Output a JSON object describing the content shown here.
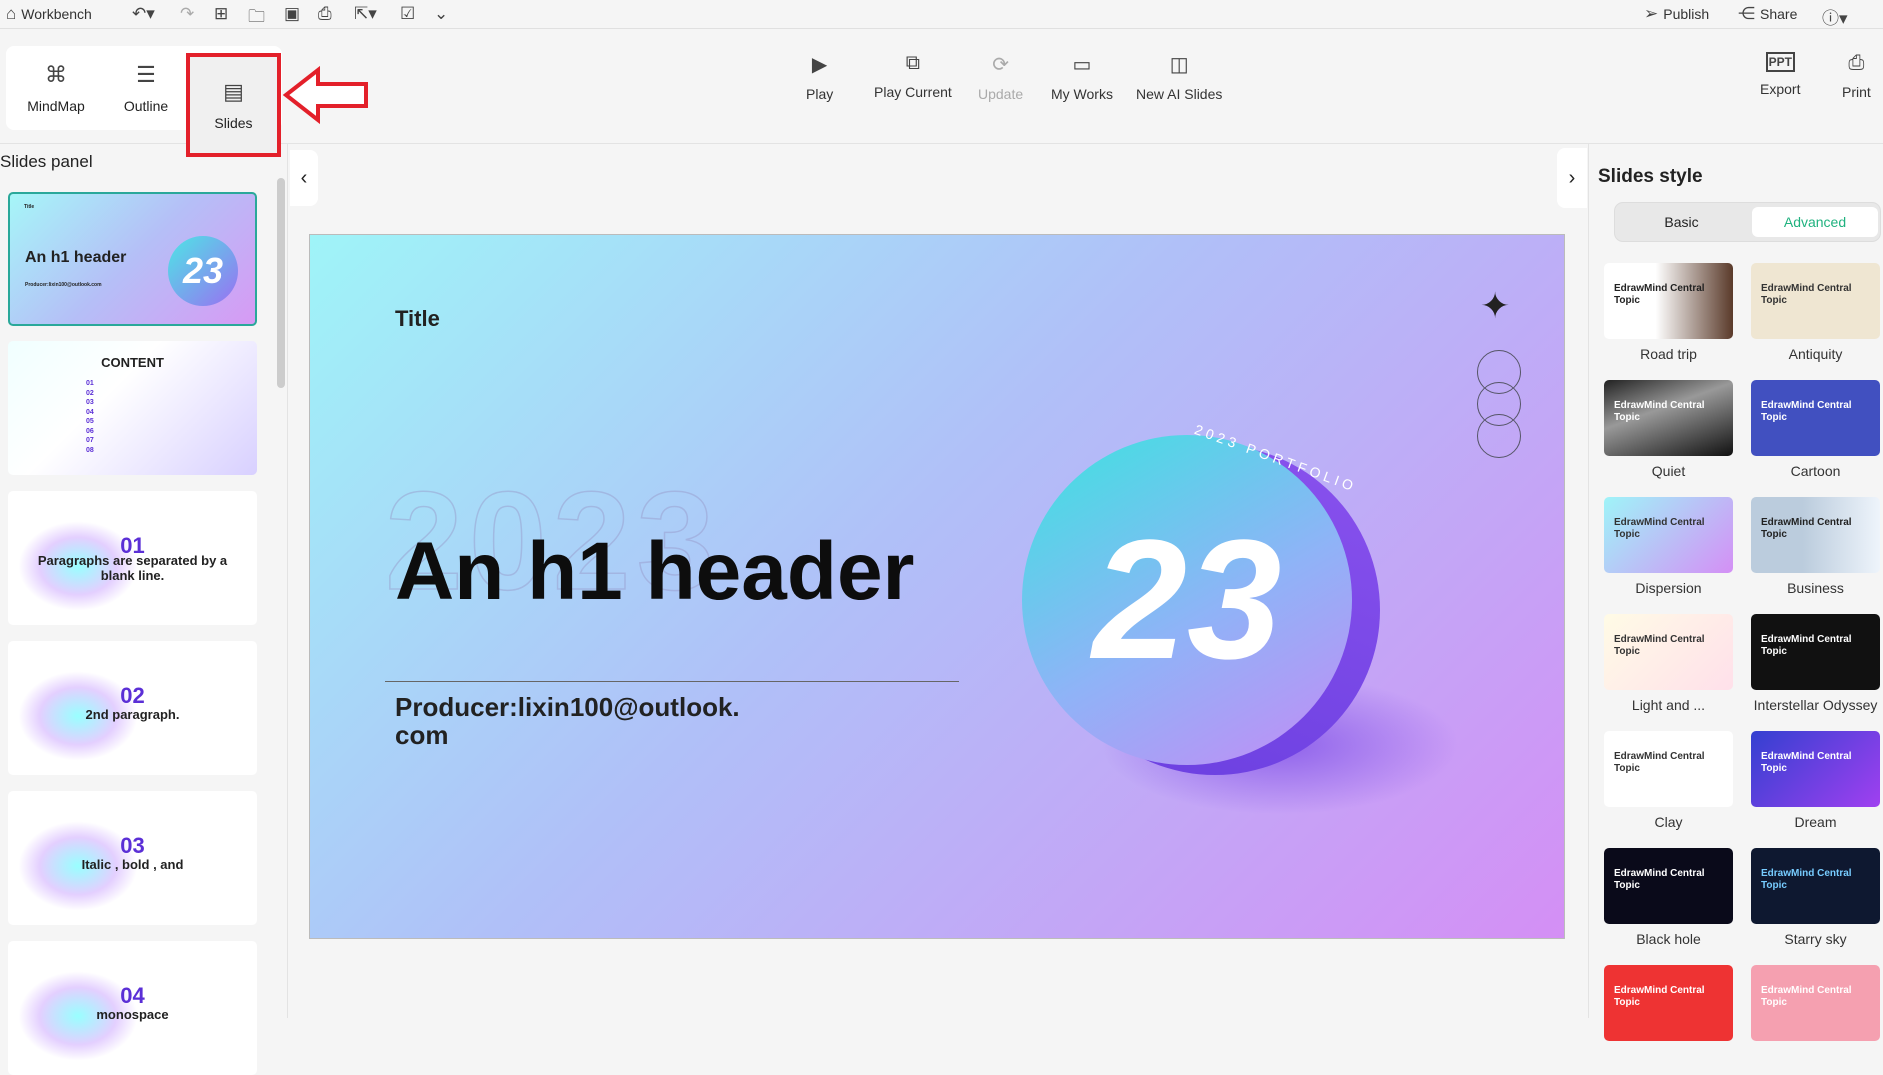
{
  "topbar": {
    "workbench": "Workbench",
    "publish": "Publish",
    "share": "Share"
  },
  "modes": [
    {
      "label": "MindMap"
    },
    {
      "label": "Outline"
    },
    {
      "label": "Slides"
    }
  ],
  "tools": [
    {
      "label": "Play"
    },
    {
      "label": "Play Current"
    },
    {
      "label": "Update",
      "disabled": true
    },
    {
      "label": "My Works"
    },
    {
      "label": "New AI Slides"
    }
  ],
  "right_tools": [
    {
      "label": "Export",
      "icon": "PPT"
    },
    {
      "label": "Print"
    }
  ],
  "slides_panel": {
    "title": "Slides panel",
    "slides": [
      {
        "title": "Title",
        "h1": "An h1 header",
        "producer": "Producer:lixin100@outlook.com",
        "num": "23"
      },
      {
        "title": "CONTENT",
        "items": [
          "01",
          "02",
          "03",
          "04",
          "05",
          "06",
          "07",
          "08"
        ]
      },
      {
        "num": "01",
        "text": "Paragraphs are separated by a blank line."
      },
      {
        "num": "02",
        "text": "2nd paragraph."
      },
      {
        "num": "03",
        "text": "Italic , bold , and"
      },
      {
        "num": "04",
        "text": "monospace"
      }
    ]
  },
  "slide": {
    "title": "Title",
    "bg_text": "2023",
    "h1": "An h1 header",
    "producer_line1": "Producer:lixin100@outlook.",
    "producer_line2": "com",
    "badge": "23",
    "ring_text": "2023 PORTFOLIO"
  },
  "style_panel": {
    "title": "Slides style",
    "tabs": [
      "Basic",
      "Advanced"
    ],
    "active_tab": "Advanced",
    "accent": "#20b27f",
    "thumb_text": "EdrawMind Central Topic",
    "styles": [
      "Road trip",
      "Antiquity",
      "Quiet",
      "Cartoon",
      "Dispersion",
      "Business",
      "Light and ...",
      "Interstellar Odyssey",
      "Clay",
      "Dream",
      "Black hole",
      "Starry sky"
    ]
  }
}
